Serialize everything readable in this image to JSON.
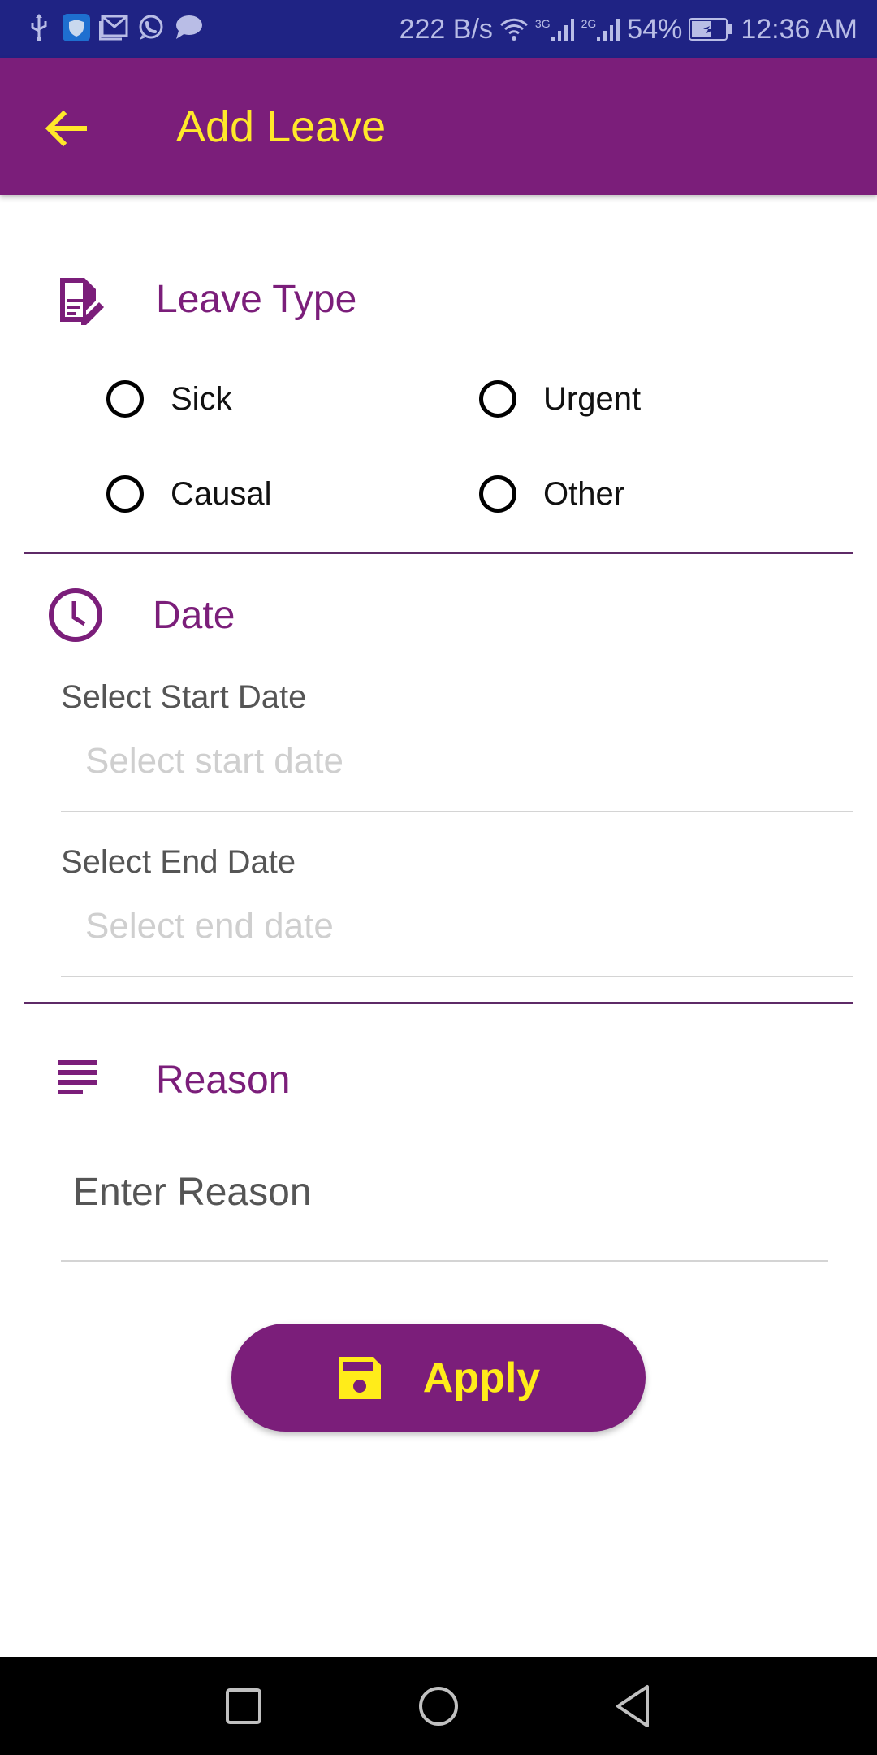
{
  "status_bar": {
    "notification_icons": [
      "usb-icon",
      "shield-app-icon",
      "gmail-icon",
      "whatsapp-icon",
      "message-icon"
    ],
    "network_speed": "222 B/s",
    "wifi_icon": "wifi-icon",
    "sim1_label": "3G",
    "sim2_label": "2G",
    "battery_percent": "54%",
    "time": "12:36 AM"
  },
  "app_bar": {
    "back_icon": "arrow-back-icon",
    "title": "Add Leave"
  },
  "leave_type": {
    "label": "Leave Type",
    "icon": "document-edit-icon",
    "options": [
      {
        "label": "Sick",
        "selected": false
      },
      {
        "label": "Urgent",
        "selected": false
      },
      {
        "label": "Causal",
        "selected": false
      },
      {
        "label": "Other",
        "selected": false
      }
    ]
  },
  "date": {
    "label": "Date",
    "icon": "clock-icon",
    "start": {
      "label": "Select Start Date",
      "placeholder": "Select start date",
      "value": ""
    },
    "end": {
      "label": "Select End Date",
      "placeholder": "Select end date",
      "value": ""
    }
  },
  "reason": {
    "label": "Reason",
    "icon": "notes-icon",
    "placeholder": "Enter Reason",
    "value": ""
  },
  "apply_button": {
    "label": "Apply",
    "icon": "save-icon"
  },
  "nav_bar": {
    "buttons": [
      "recents",
      "home",
      "back"
    ]
  },
  "colors": {
    "primary": "#7b1e7a",
    "accent": "#ffec1a",
    "status_bar": "#1f2384",
    "divider": "#5e2a67"
  }
}
